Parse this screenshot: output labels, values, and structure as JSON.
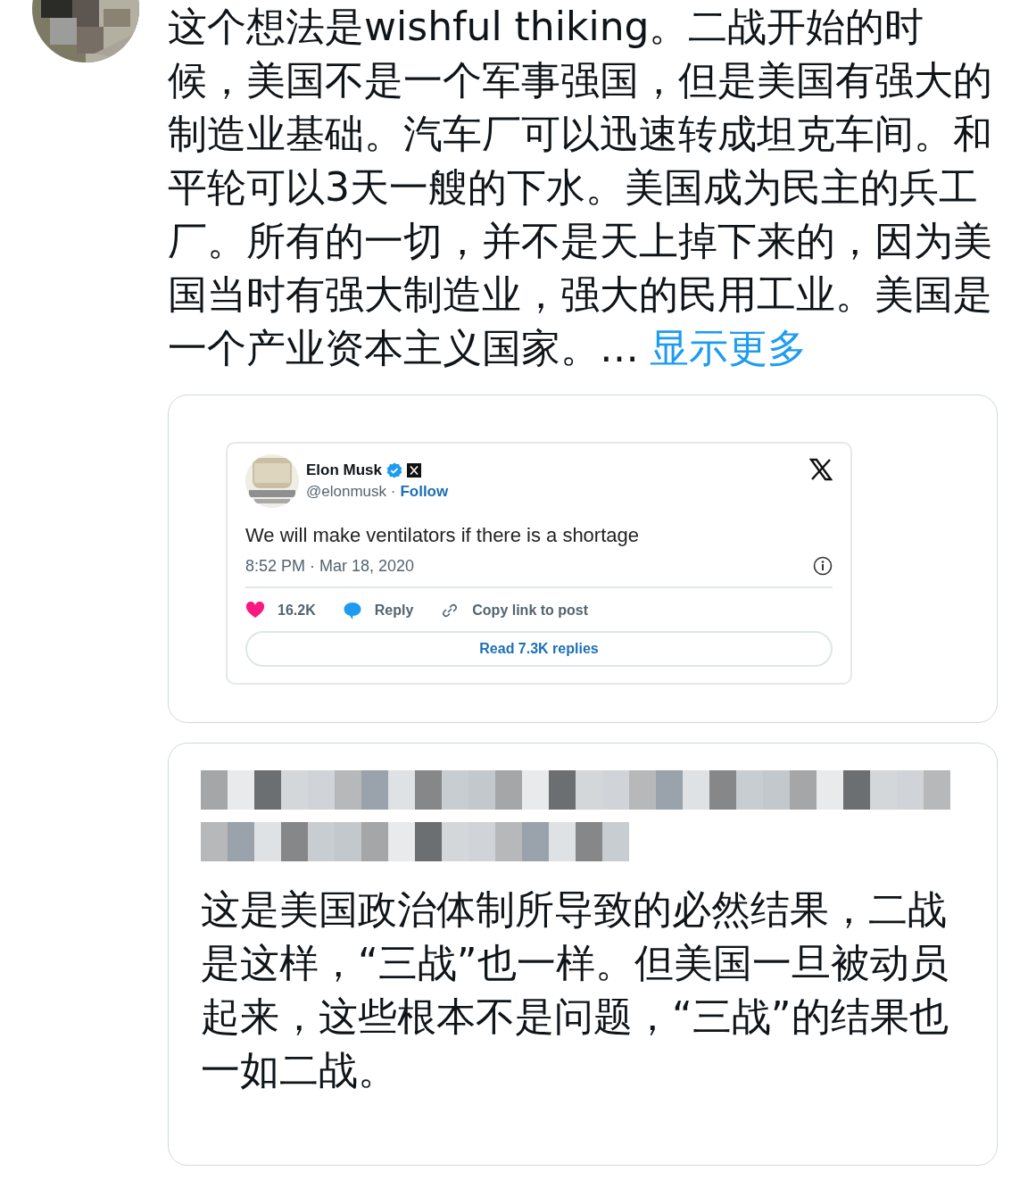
{
  "post": {
    "text": "这个想法是wishful thiking。二战开始的时候，美国不是一个军事强国，但是美国有强大的制造业基础。汽车厂可以迅速转成坦克车间。和平轮可以3天一艘的下水。美国成为民主的兵工厂。所有的一切，并不是天上掉下来的，因为美国当时有强大制造业，强大的民用工业。美国是一个产业资本主义国家。…",
    "more_link": "显示更多"
  },
  "embedded_tweet": {
    "name": "Elon Musk",
    "handle": "@elonmusk ·",
    "follow": "Follow",
    "verified": true,
    "text": "We will make ventilators if there is a shortage",
    "time": "8:52 PM · Mar 18, 2020",
    "actions": [
      {
        "kind": "like",
        "label": "16.2K"
      },
      {
        "kind": "reply",
        "label": "Reply"
      },
      {
        "kind": "copy",
        "label": "Copy link to post"
      }
    ],
    "read_replies": "Read 7.3K replies"
  },
  "quoted_post": {
    "text": "这是美国政治体制所导致的必然结果，二战是这样，“三战”也一样。但美国一旦被动员起来，这些根本不是问题，“三战”的结果也一如二战。"
  }
}
